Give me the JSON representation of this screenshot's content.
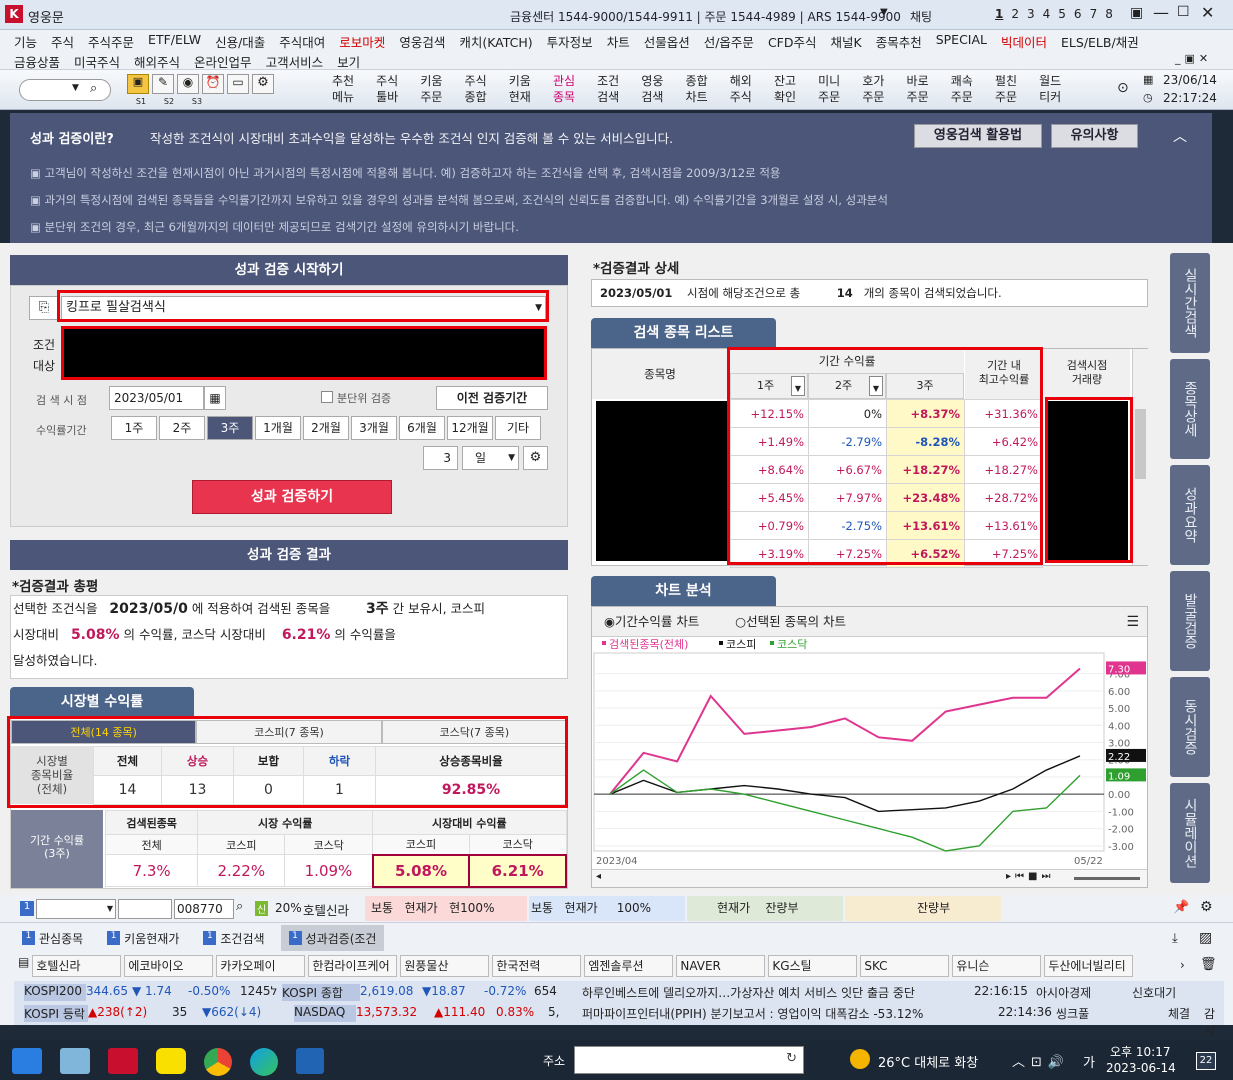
{
  "title": {
    "app": "영웅문",
    "center": "금융센터 1544-9000/1544-9911 | 주문 1544-4989 | ARS 1544-9900",
    "chat": "채팅",
    "pages": [
      "1",
      "2",
      "3",
      "4",
      "5",
      "6",
      "7",
      "8"
    ]
  },
  "menu": {
    "row1": [
      "기능",
      "주식",
      "주식주문",
      "ETF/ELW",
      "신용/대출",
      "주식대여",
      "로보마켓",
      "영웅검색",
      "캐치(KATCH)",
      "투자정보",
      "차트",
      "선물옵션",
      "선/옵주문",
      "CFD주식",
      "채널K",
      "종목추천",
      "SPECIAL",
      "빅데이터",
      "ELS/ELB/채권"
    ],
    "row2": [
      "금융상품",
      "미국주식",
      "해외주식",
      "온라인업무",
      "고객서비스",
      "보기"
    ]
  },
  "toolbar": {
    "slots": [
      "S1",
      "S2",
      "S3"
    ],
    "buttons": [
      "추천\n메뉴",
      "주식\n툴바",
      "키움\n주문",
      "주식\n종합",
      "키움\n현재",
      "관심\n종목",
      "조건\n검색",
      "영웅\n검색",
      "종합\n차트",
      "해외\n주식",
      "잔고\n확인",
      "미니\n주문",
      "호가\n주문",
      "바로\n주문",
      "쾌속\n주문",
      "펄친\n주문",
      "월드\n티커"
    ],
    "date": "23/06/14",
    "time": "22:17:24"
  },
  "info": {
    "heading": "성과 검증이란?",
    "lead": "작성한 조건식이 시장대비 초과수익을 달성하는 우수한 조건식 인지 검증해 볼 수 있는 서비스입니다.",
    "btn_guide": "영웅검색 활용법",
    "btn_notice": "유의사항",
    "notes": [
      "고객님이 작성하신 조건을 현재시점이 아닌 과거시점의 특정시점에 적용해 봅니다.   예) 검증하고자 하는 조건식을 선택 후, 검색시점을 2009/3/12로 적용",
      "과거의 특정시점에 검색된 종목들을 수익률기간까지 보유하고 있을 경우의 성과를 분석해 봄으로써, 조건식의 신뢰도를 검증합니다.  예) 수익률기간을 3개월로 설정 시, 성과분석",
      "분단위 조건의 경우, 최근 6개월까지의 데이터만 제공되므로 검색기간 설정에 유의하시기 바랍니다."
    ]
  },
  "left": {
    "start_title": "성과 검증 시작하기",
    "formula": "킹프로 필살검색식",
    "cond_label": "조건",
    "target_label": "대상",
    "search_label": "검 색 시 점",
    "search_date": "2023/05/01",
    "minute_label": "분단위 검증",
    "prev_btn": "이전 검증기간",
    "period_label": "수익률기간",
    "periods": [
      "1주",
      "2주",
      "3주",
      "1개월",
      "2개월",
      "3개월",
      "6개월",
      "12개월",
      "기타"
    ],
    "custom_num": "3",
    "custom_unit": "일",
    "run_btn": "성과 검증하기",
    "result_title": "성과 검증 결과",
    "summary_title": "*검증결과 총평",
    "summary_l1a": "선택한 조건식을",
    "summary_date": "2023/05/0",
    "summary_l1b": "에 적용하여 검색된 종목을",
    "summary_period": "3주",
    "summary_l1c": "간 보유시, 코스피",
    "summary_l2a": "시장대비",
    "kospi_excess": "5.08%",
    "summary_l2b": "의 수익률, 코스닥 시장대비",
    "kosdaq_excess": "6.21%",
    "summary_l2c": "의 수익률을",
    "summary_l3": "달성하였습니다.",
    "market_title": "시장별 수익률",
    "market_tabs": [
      "전체(14 종목)",
      "코스피(7 종목)",
      "코스닥(7 종목)"
    ],
    "ratio_label": "시장별\n종목비율\n(전체)",
    "ratio_heads": [
      "전체",
      "상승",
      "보합",
      "하락",
      "상승종목비율"
    ],
    "ratio_vals": [
      "14",
      "13",
      "0",
      "1",
      "92.85%"
    ],
    "ret_label": "기간 수익률\n(3주)",
    "ret_groups": [
      "검색된종목",
      "시장 수익률",
      "시장대비 수익률"
    ],
    "ret_sub": [
      "전체",
      "코스피",
      "코스닥",
      "코스피",
      "코스닥"
    ],
    "ret_vals": [
      "7.3%",
      "2.22%",
      "1.09%",
      "5.08%",
      "6.21%"
    ]
  },
  "right": {
    "detail_title": "*검증결과 상세",
    "detail_date": "2023/05/01",
    "detail_a": "시점에 해당조건으로 총",
    "detail_count": "14",
    "detail_b": "개의 종목이 검색되었습니다.",
    "list_tab": "검색 종목 리스트",
    "col_name": "종목명",
    "col_period": "기간 수익률",
    "col_sub": [
      "1주",
      "2주",
      "3주"
    ],
    "col_max": "기간 내\n최고수익률",
    "col_vol": "검색시점\n거래량",
    "rows": [
      [
        "+12.15%",
        "0%",
        "+8.37%",
        "+31.36%"
      ],
      [
        "+1.49%",
        "-2.79%",
        "-8.28%",
        "+6.42%"
      ],
      [
        "+8.64%",
        "+6.67%",
        "+18.27%",
        "+18.27%"
      ],
      [
        "+5.45%",
        "+7.97%",
        "+23.48%",
        "+28.72%"
      ],
      [
        "+0.79%",
        "-2.75%",
        "+13.61%",
        "+13.61%"
      ],
      [
        "+3.19%",
        "+7.25%",
        "+6.52%",
        "+7.25%"
      ]
    ],
    "chart_tab": "차트 분석",
    "radio_a": "기간수익률 차트",
    "radio_b": "선택된 종목의 차트"
  },
  "side": [
    "실시간검색",
    "종목상세",
    "성과요약",
    "발굴검증",
    "동시검증",
    "시뮬레이션"
  ],
  "bottom": {
    "code": "008770",
    "sin": "신",
    "pct": "20%",
    "stock": "호텔신라",
    "q1": "보통",
    "q2": "현재가",
    "q3": "현100%",
    "q4": "보통",
    "q5": "현재가",
    "q6": "100%",
    "q7": "현재가",
    "q8": "잔량부",
    "q9": "잔량부",
    "tabs": [
      "관심종목",
      "키움현재가",
      "조건검색",
      "성과검증(조건"
    ],
    "stocks": [
      "호텔신라",
      "에코바이오",
      "카카오페이",
      "한컴라이프케어",
      "원풍물산",
      "한국전력",
      "엠젠솔루션",
      "NAVER",
      "KG스틸",
      "SKC",
      "유니슨",
      "두산에너빌리티"
    ],
    "t1": [
      "KOSPI200",
      "344.65",
      "▼ 1.74",
      "-0.50%",
      "124ל5",
      "KOSPI 종합",
      "2,619.08",
      "▼18.87",
      "-0.72%",
      "654"
    ],
    "news1": "하루인베스트에 델리오까지…가상자산 예치 서비스 잇단 출금 중단",
    "time1": "22:16:15",
    "src1": "아시아경제",
    "t2": [
      "KOSPI 등락",
      "▲238(↑2)",
      "35",
      "▼662(↓4)",
      "NASDAQ",
      "13,573.32",
      "▲111.40",
      "0.83%",
      "5,"
    ],
    "news2": "퍼마파이프인터내(PPIH) 분기보고서 : 영업이익 대폭감소 -53.12%",
    "time2": "22:14:36",
    "src2": "씽크풀",
    "link": "신호대기",
    "r1": "체결",
    "r2": "감시"
  },
  "taskbar": {
    "addr_label": "주소",
    "weather": "26°C 대체로 화창",
    "ime": "가",
    "time": "오후 10:17",
    "date": "2023-06-14",
    "badge": "22"
  },
  "chart_data": {
    "type": "line",
    "legend": [
      "검색된종목(전체)",
      "코스피",
      "코스닥"
    ],
    "x_start": "2023/04",
    "x_end": "05/22",
    "ylim": [
      -3.3,
      7.5
    ],
    "yticks": [
      "7.00",
      "6.00",
      "5.00",
      "4.00",
      "3.00",
      "2.00",
      "1.00",
      "0.00",
      "-1.00",
      "-2.00",
      "-3.00"
    ],
    "last_labels": [
      "7.30",
      "2.22",
      "1.09"
    ],
    "series": [
      {
        "name": "검색된종목(전체)",
        "color": "#e0358f",
        "values": [
          0,
          2.4,
          1.9,
          5.7,
          3.5,
          3.7,
          3.9,
          4.4,
          3.3,
          3.1,
          4.8,
          5.2,
          5.6,
          5.6,
          7.3
        ]
      },
      {
        "name": "코스피",
        "color": "#111111",
        "values": [
          0,
          0.8,
          0.1,
          0.3,
          0.5,
          0.3,
          0.0,
          -0.2,
          -1.0,
          -0.9,
          -0.8,
          -0.4,
          0.3,
          1.4,
          2.22
        ]
      },
      {
        "name": "코스닥",
        "color": "#2fa02f",
        "values": [
          0,
          1.4,
          0.1,
          0.3,
          0,
          -0.5,
          -1.0,
          -1.5,
          -2.0,
          -2.5,
          -3.3,
          -3.0,
          -1.0,
          -0.8,
          1.09
        ]
      }
    ]
  }
}
